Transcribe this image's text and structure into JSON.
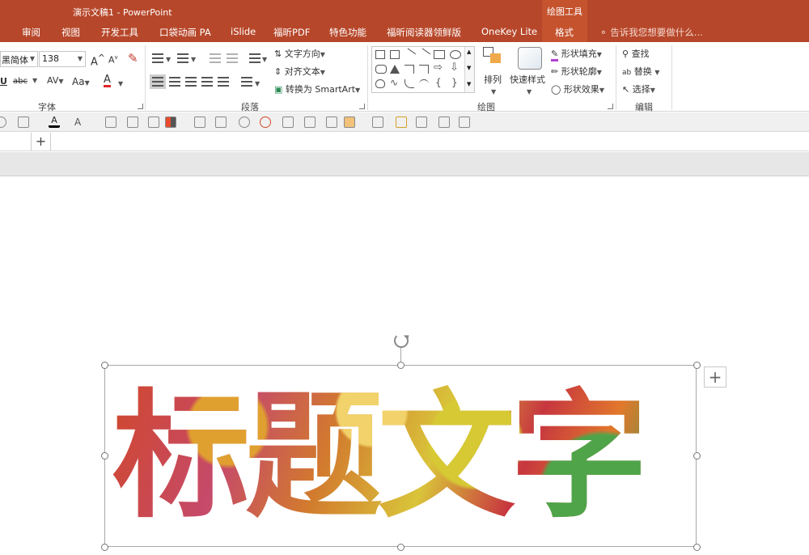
{
  "title_bar": {
    "doc_title": "演示文稿1 - PowerPoint",
    "context_group": "绘图工具",
    "tell_me": "告诉我您想要做什么..."
  },
  "tabs": [
    "审阅",
    "视图",
    "开发工具",
    "口袋动画 PA",
    "iSlide",
    "福昕PDF",
    "特色功能",
    "福昕阅读器领鲜版",
    "OneKey Lite",
    "格式"
  ],
  "ribbon": {
    "font": {
      "group_label": "字体",
      "font_name": "黑简体",
      "font_size": "138",
      "grow_label": "A",
      "shrink_label": "A",
      "underline": "U",
      "strike": "abc",
      "spacing": "AV",
      "case": "Aa",
      "color_a": "A"
    },
    "paragraph": {
      "group_label": "段落",
      "text_direction": "文字方向",
      "align_text": "对齐文本",
      "convert_smartart": "转换为 SmartArt"
    },
    "drawing": {
      "group_label": "绘图",
      "arrange": "排列",
      "quick_styles": "快速样式",
      "shape_fill": "形状填充",
      "shape_outline": "形状轮廓",
      "shape_effects": "形状效果"
    },
    "editing": {
      "group_label": "编辑",
      "find": "查找",
      "replace": "替换",
      "select": "选择"
    }
  },
  "section_bar": {
    "add": "+"
  },
  "slide": {
    "wordart": "标题文字",
    "layout_options": "+"
  },
  "colors": {
    "accent": "#b7472a",
    "format_tab": "#c5532e"
  }
}
